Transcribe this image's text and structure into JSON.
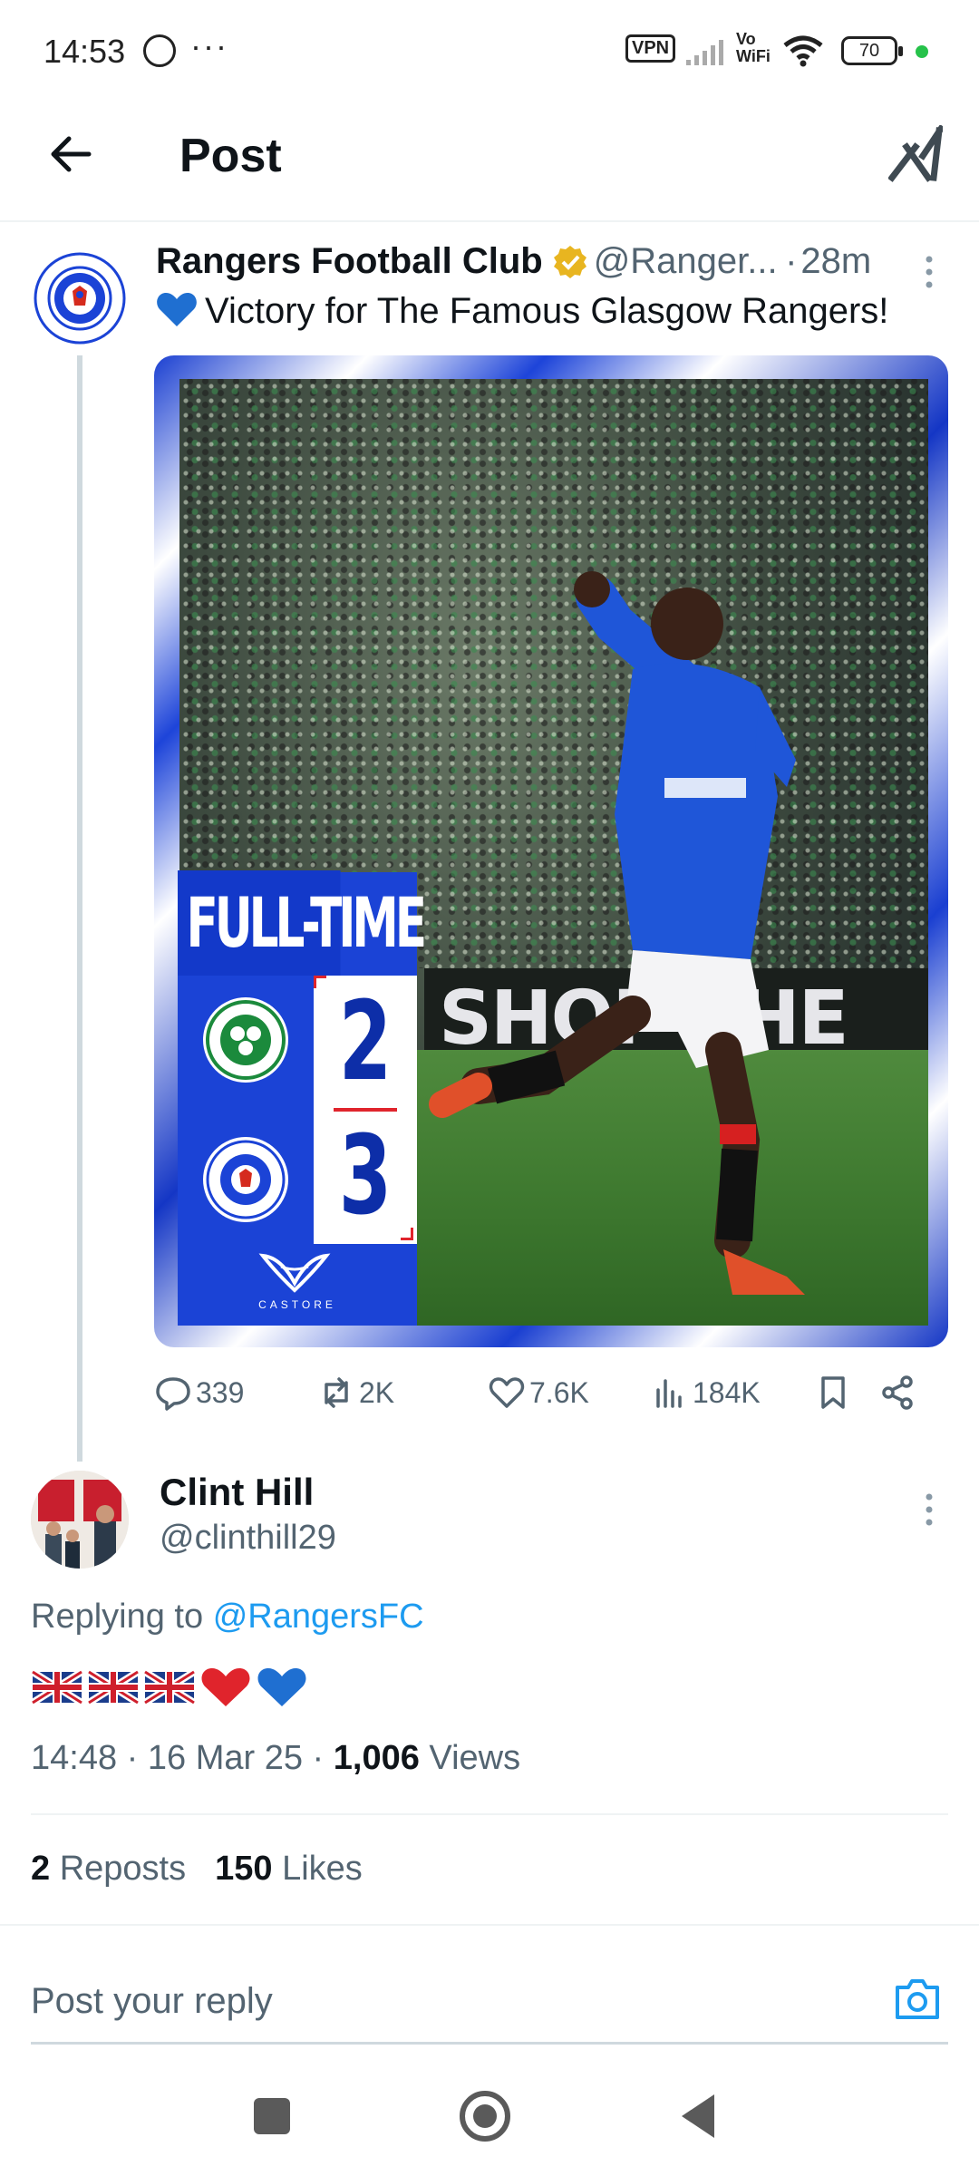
{
  "status_bar": {
    "time": "14:53",
    "dots": "···",
    "vpn": "VPN",
    "vowifi_line1": "Vo",
    "vowifi_line2": "WiFi",
    "battery": "70"
  },
  "header": {
    "title": "Post"
  },
  "post": {
    "author_name": "Rangers Football Club",
    "handle": "@Ranger...",
    "separator": "·",
    "time_ago": "28m",
    "text": "Victory for The Famous Glasgow Rangers!",
    "media": {
      "ft_title": "FULL-TIME",
      "score_home": "2",
      "score_away": "3",
      "ad_text": "SHOP  THE",
      "castore": "CASTORE"
    },
    "actions": {
      "replies": "339",
      "reposts": "2K",
      "likes": "7.6K",
      "views": "184K"
    }
  },
  "reply": {
    "author_name": "Clint Hill",
    "handle": "@clinthill29",
    "replying_label": "Replying to",
    "replying_handle": "@RangersFC",
    "time": "14:48",
    "date": "16 Mar 25",
    "views_count": "1,006",
    "views_label": "Views",
    "meta_sep": " · ",
    "reposts_count": "2",
    "reposts_label": "Reposts",
    "likes_count": "150",
    "likes_label": "Likes"
  },
  "composer": {
    "placeholder": "Post your reply"
  },
  "colors": {
    "accent": "#1d9bf0",
    "rangers_blue": "#1b43d6",
    "verified_gold": "#e8b520",
    "text_secondary": "#536471"
  }
}
